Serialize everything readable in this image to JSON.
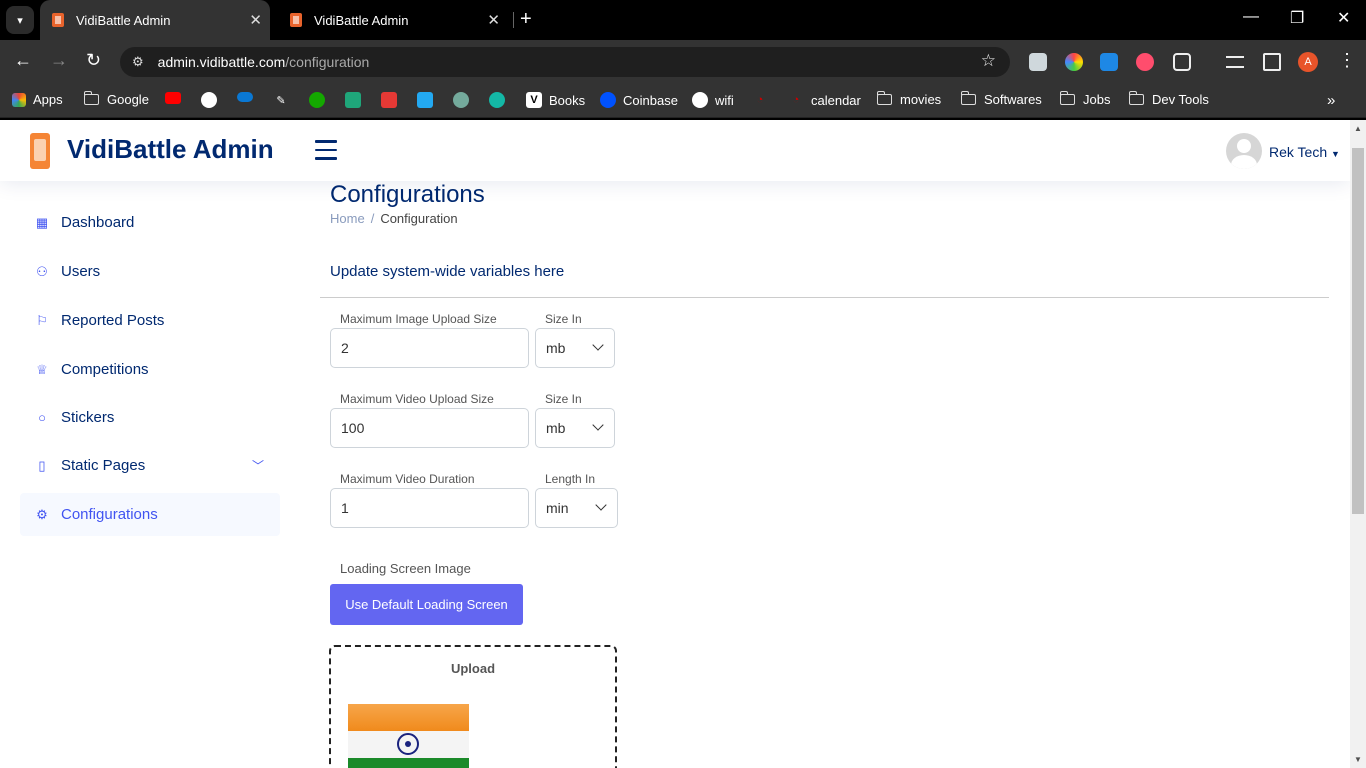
{
  "browser": {
    "tabs": [
      {
        "title": "VidiBattle Admin",
        "active": true
      },
      {
        "title": "VidiBattle Admin",
        "active": false
      }
    ],
    "url_host": "admin.vidibattle.com",
    "url_path": "/configuration",
    "profile_initial": "A",
    "bookmarks": {
      "apps": "Apps",
      "google": "Google",
      "books": "Books",
      "coinbase": "Coinbase",
      "wifi": "wifi",
      "calendar": "calendar",
      "movies": "movies",
      "softwares": "Softwares",
      "jobs": "Jobs",
      "devtools": "Dev Tools"
    }
  },
  "header": {
    "logo_text": "VidiBattle Admin",
    "user_name": "Rek Tech"
  },
  "sidebar": {
    "items": [
      {
        "label": "Dashboard",
        "icon": "grid-icon"
      },
      {
        "label": "Users",
        "icon": "people-icon"
      },
      {
        "label": "Reported Posts",
        "icon": "flag-icon"
      },
      {
        "label": "Competitions",
        "icon": "trophy-icon"
      },
      {
        "label": "Stickers",
        "icon": "circle-icon"
      },
      {
        "label": "Static Pages",
        "icon": "file-icon"
      },
      {
        "label": "Configurations",
        "icon": "gear-icon",
        "active": true
      }
    ]
  },
  "main": {
    "title": "Configurations",
    "breadcrumb": {
      "home": "Home",
      "sep": "/",
      "current": "Configuration"
    },
    "card_title": "Update system-wide variables here",
    "fields": {
      "image_size_label": "Maximum Image Upload Size",
      "image_size_value": "2",
      "image_unit_label": "Size In",
      "image_unit_value": "mb",
      "video_size_label": "Maximum Video Upload Size",
      "video_size_value": "100",
      "video_unit_label": "Size In",
      "video_unit_value": "mb",
      "video_duration_label": "Maximum Video Duration",
      "video_duration_value": "1",
      "duration_unit_label": "Length In",
      "duration_unit_value": "min"
    },
    "loading_label": "Loading Screen Image",
    "default_button": "Use Default Loading Screen",
    "upload_label": "Upload"
  },
  "colors": {
    "accent": "#4154f1",
    "navy": "#012970",
    "button": "#6366f1"
  }
}
